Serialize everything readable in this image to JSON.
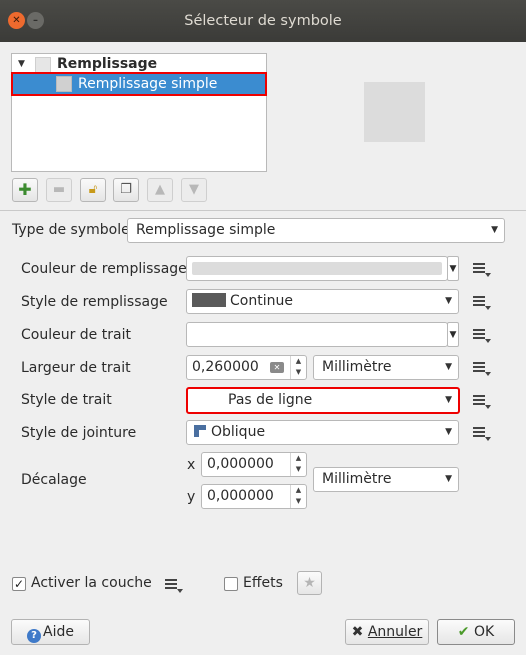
{
  "window": {
    "title": "Sélecteur de symbole"
  },
  "tree": {
    "root_label": "Remplissage",
    "child_label": "Remplissage simple"
  },
  "toolbar": {
    "add_label": "Ajouter une couche",
    "remove_label": "Supprimer la couche",
    "lock_label": "Verrouiller la couleur",
    "duplicate_label": "Dupliquer la couche",
    "up_label": "Monter",
    "down_label": "Descendre"
  },
  "symbol_type": {
    "label": "Type de symbole",
    "value": "Remplissage simple"
  },
  "fields": {
    "fill_color_label": "Couleur de remplissage",
    "fill_style_label": "Style de remplissage",
    "fill_style_value": "Continue",
    "stroke_color_label": "Couleur de trait",
    "stroke_width_label": "Largeur de trait",
    "stroke_width_value": "0,260000",
    "stroke_width_unit": "Millimètre",
    "stroke_style_label": "Style de trait",
    "stroke_style_value": "Pas de ligne",
    "join_style_label": "Style de jointure",
    "join_style_value": "Oblique",
    "offset_label": "Décalage",
    "offset_x_label": "x",
    "offset_x_value": "0,000000",
    "offset_y_label": "y",
    "offset_y_value": "0,000000",
    "offset_unit": "Millimètre"
  },
  "colors": {
    "fill_color": "#dcdcdc",
    "stroke_color": "#ffffff",
    "fill_style_swatch": "#5a5a5a",
    "selection": "#3b8cd0",
    "highlight": "#e00000"
  },
  "bottom": {
    "enable_layer_label": "Activer la couche",
    "enable_layer_checked": true,
    "effects_label": "Effets",
    "effects_checked": false
  },
  "buttons": {
    "help": "Aide",
    "cancel": "Annuler",
    "ok": "OK"
  }
}
